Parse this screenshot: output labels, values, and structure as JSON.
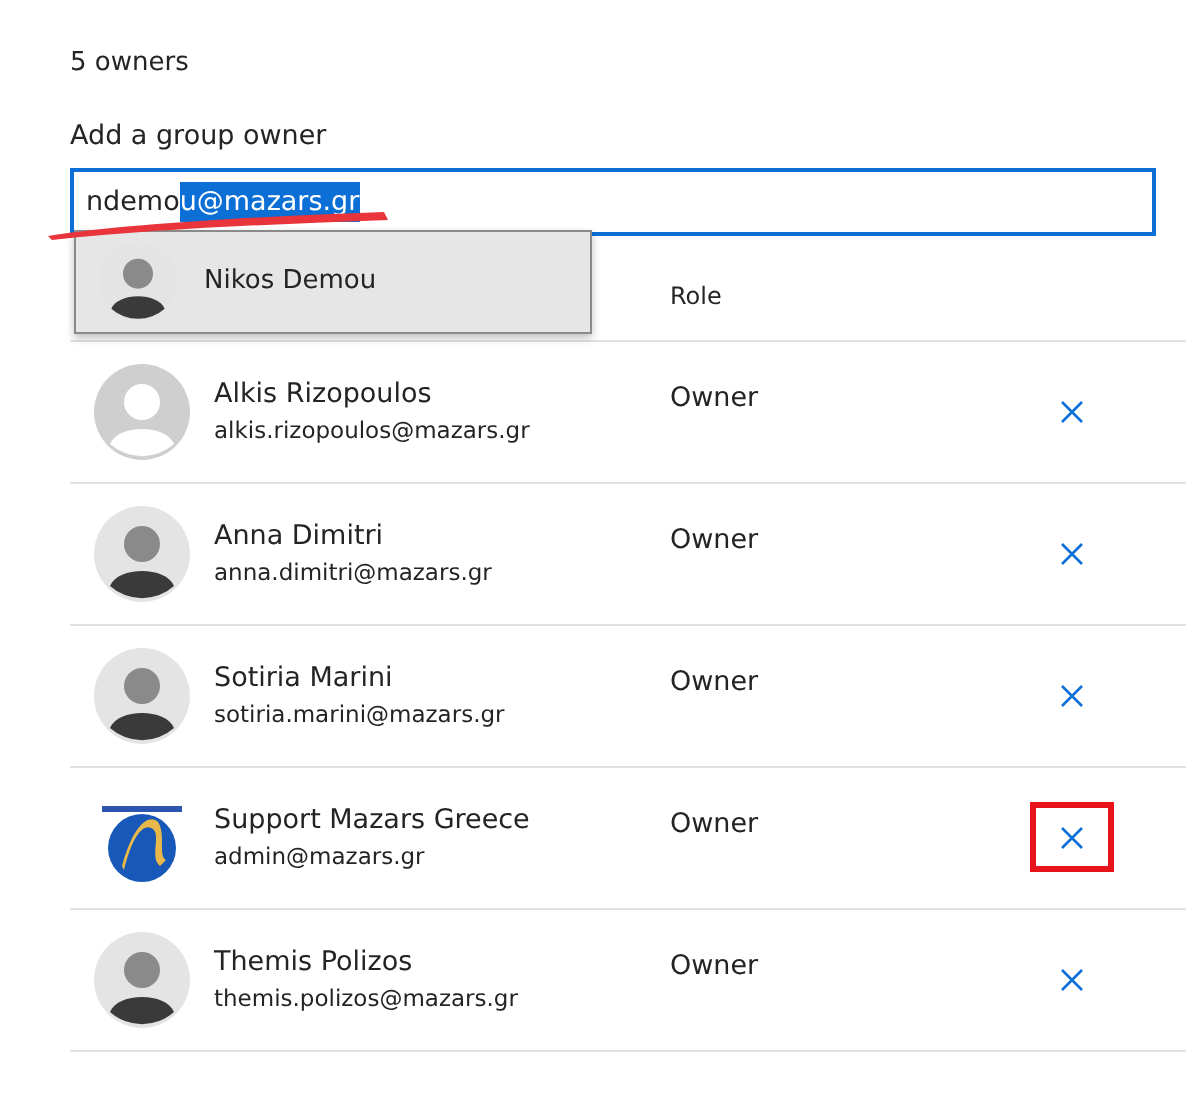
{
  "owner_count": "5 owners",
  "add_owner": {
    "label": "Add a group owner",
    "typed": "ndemo",
    "selected_completion": "u@mazars.gr"
  },
  "suggestions": [
    {
      "name": "Nikos Demou",
      "kind": "photo"
    }
  ],
  "table": {
    "role_column": "Role",
    "rows": [
      {
        "name": "Alkis Rizopoulos",
        "email": "alkis.rizopoulos@mazars.gr",
        "role": "Owner",
        "kind": "placeholder",
        "highlighted": false
      },
      {
        "name": "Anna Dimitri",
        "email": "anna.dimitri@mazars.gr",
        "role": "Owner",
        "kind": "photo",
        "highlighted": false
      },
      {
        "name": "Sotiria Marini",
        "email": "sotiria.marini@mazars.gr",
        "role": "Owner",
        "kind": "photo",
        "highlighted": false
      },
      {
        "name": "Support Mazars Greece",
        "email": "admin@mazars.gr",
        "role": "Owner",
        "kind": "logo",
        "highlighted": true
      },
      {
        "name": "Themis Polizos",
        "email": "themis.polizos@mazars.gr",
        "role": "Owner",
        "kind": "photo",
        "highlighted": false
      }
    ]
  }
}
